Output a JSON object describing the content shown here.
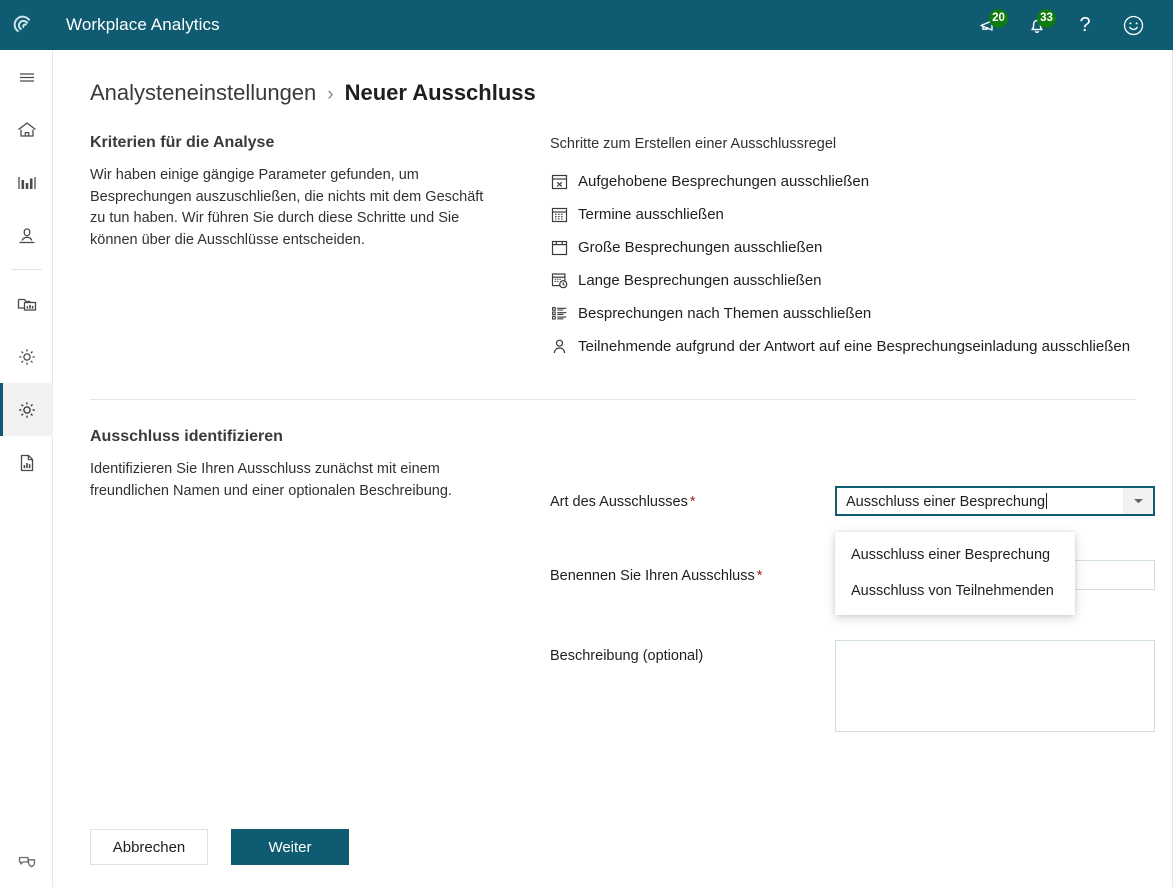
{
  "topbar": {
    "brand_logo_icon": "spiral-logo-icon",
    "title": "Workplace Analytics",
    "bg_color": "#0f5c72",
    "actions": [
      {
        "icon": "megaphone-icon",
        "badge": "20",
        "badge_color": "#107c10"
      },
      {
        "icon": "bell-icon",
        "badge": "33",
        "badge_color": "#107c10"
      },
      {
        "icon": "help-question-icon",
        "glyph": "?"
      },
      {
        "icon": "smiley-feedback-icon"
      }
    ]
  },
  "rail": {
    "items": [
      {
        "name": "hamburger-menu",
        "icon": "hamburger-icon",
        "selected": false
      },
      {
        "name": "home",
        "icon": "home-icon",
        "selected": false
      },
      {
        "name": "explore",
        "icon": "bar-chart-icon",
        "selected": false
      },
      {
        "name": "insights",
        "icon": "person-insight-icon",
        "selected": false
      },
      {
        "name": "analysis",
        "icon": "folder-chart-icon",
        "selected": false
      },
      {
        "name": "settings",
        "icon": "gear-icon",
        "selected": false
      },
      {
        "name": "analyst-settings",
        "icon": "gear-icon",
        "selected": true
      },
      {
        "name": "reports",
        "icon": "document-chart-icon",
        "selected": false
      }
    ],
    "bottom_item": {
      "name": "feedback",
      "icon": "feedback-shield-icon"
    },
    "selected_indicator_color": "#0f5c72"
  },
  "breadcrumb": {
    "parent": "Analysteneinstellungen",
    "separator": "›",
    "current": "Neuer Ausschluss"
  },
  "criteria_section": {
    "heading": "Kriterien für die Analyse",
    "body": "Wir haben einige gängige Parameter gefunden, um Besprechungen auszuschließen, die nichts mit dem Geschäft zu tun haben. Wir führen Sie durch diese Schritte und Sie können über die Ausschlüsse entscheiden."
  },
  "steps_section": {
    "heading": "Schritte zum Erstellen einer Ausschlussregel",
    "items": [
      {
        "icon": "calendar-x-icon",
        "label": "Aufgehobene Besprechungen ausschließen"
      },
      {
        "icon": "calendar-icon",
        "label": "Termine ausschließen"
      },
      {
        "icon": "calendar-empty-icon",
        "label": "Große Besprechungen ausschließen"
      },
      {
        "icon": "calendar-clock-icon",
        "label": "Lange Besprechungen ausschließen"
      },
      {
        "icon": "bulleted-list-icon",
        "label": "Besprechungen nach Themen ausschließen"
      },
      {
        "icon": "person-icon",
        "label": "Teilnehmende aufgrund der Antwort auf eine Besprechungseinladung ausschließen"
      }
    ]
  },
  "identify_section": {
    "heading": "Ausschluss identifizieren",
    "body": "Identifizieren Sie Ihren Ausschluss zunächst mit einem freundlichen Namen und einer optionalen Beschreibung."
  },
  "form": {
    "type_field": {
      "label": "Art des Ausschlusses",
      "required_mark": "*",
      "value": "Ausschluss einer Besprechung",
      "dropdown_icon": "chevron-down-icon",
      "focus_border_color": "#0f5c72",
      "options": [
        "Ausschluss einer Besprechung",
        "Ausschluss von Teilnehmenden"
      ]
    },
    "name_field": {
      "label": "Benennen Sie Ihren Ausschluss",
      "required_mark": "*",
      "value": "",
      "placeholder": ""
    },
    "description_field": {
      "label": "Beschreibung (optional)",
      "value": "",
      "placeholder": ""
    }
  },
  "footer": {
    "cancel_label": "Abbrechen",
    "next_label": "Weiter",
    "primary_color": "#0f5c72"
  }
}
